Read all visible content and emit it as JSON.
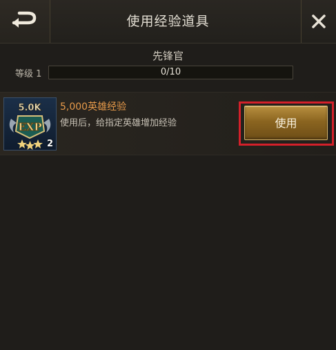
{
  "header": {
    "title": "使用经验道具"
  },
  "rank": {
    "name": "先锋官",
    "level_label": "等级 1",
    "progress_text": "0/10",
    "progress_fraction": 0
  },
  "item": {
    "icon_label": "5.0K",
    "icon_exp_text": "EXP",
    "count": "2",
    "name": "5,000英雄经验",
    "description": "使用后，给指定英雄增加经验",
    "use_label": "使用"
  },
  "colors": {
    "accent_gold": "#b88f3f",
    "item_name": "#e79a4a",
    "highlight_red": "#d4202a"
  }
}
